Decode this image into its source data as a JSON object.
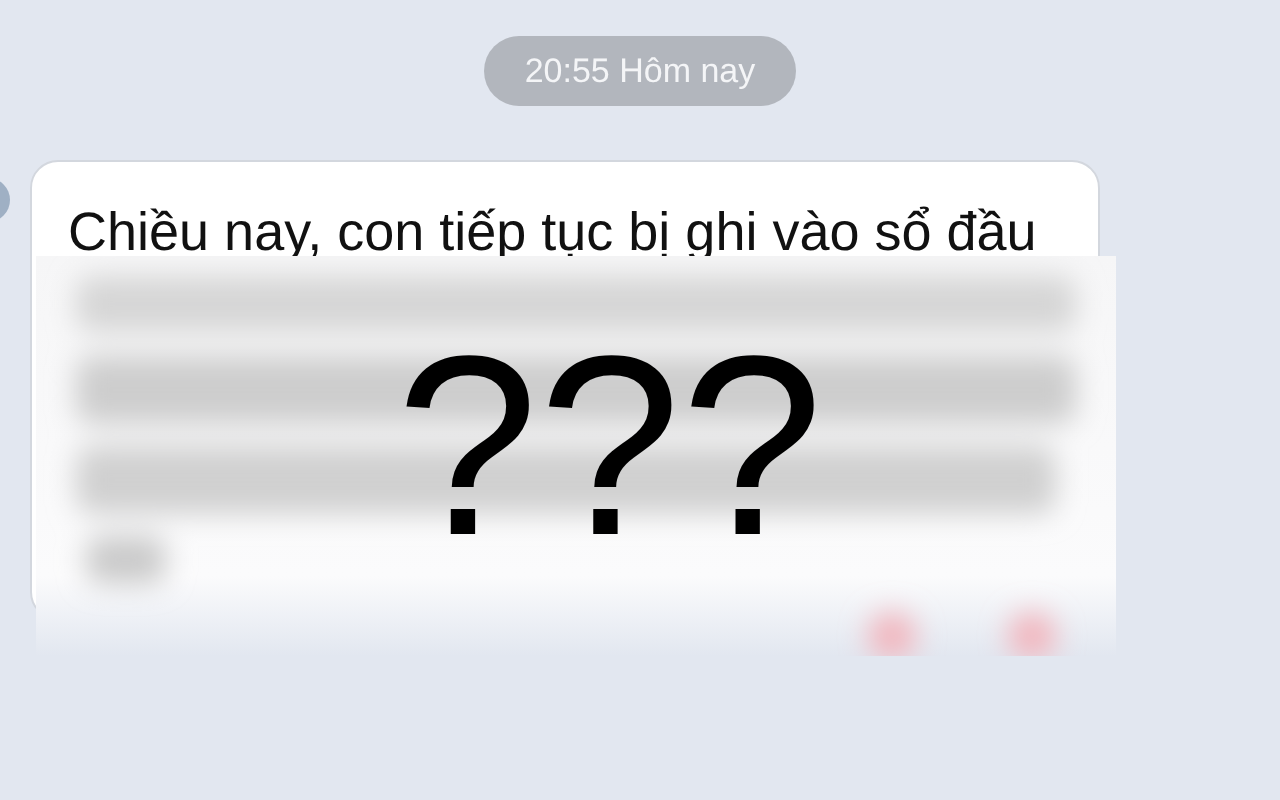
{
  "timestamp": "20:55 Hôm nay",
  "message": {
    "text": "Chiều nay, con tiếp tục bị ghi vào sổ đầu",
    "redacted": true
  },
  "overlay": {
    "text": "???"
  }
}
